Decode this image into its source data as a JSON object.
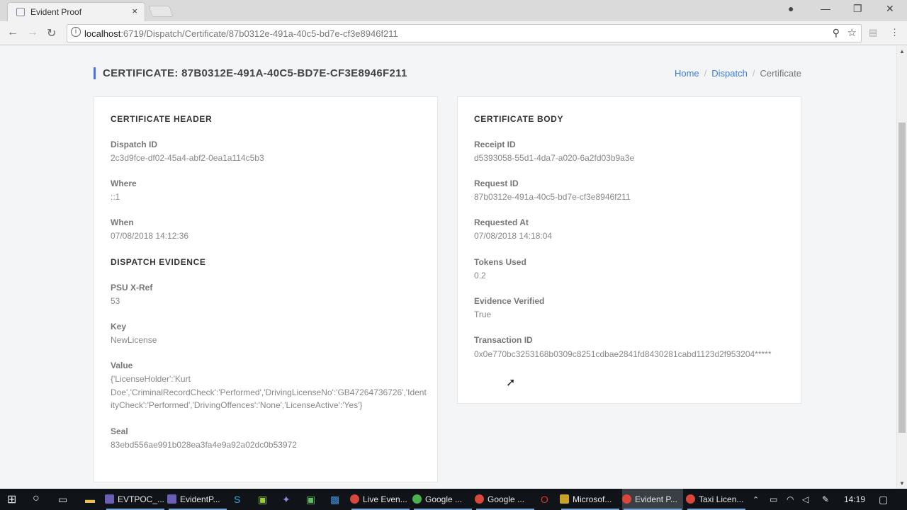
{
  "browser": {
    "tab_title": "Evident Proof",
    "tab_close": "×",
    "url_host": "localhost",
    "url_rest": ":6719/Dispatch/Certificate/87b0312e-491a-40c5-bd7e-cf3e8946f211",
    "info_glyph": "i"
  },
  "page": {
    "title": "CERTIFICATE: 87B0312E-491A-40C5-BD7E-CF3E8946F211",
    "breadcrumb": {
      "home": "Home",
      "dispatch": "Dispatch",
      "current": "Certificate",
      "separator": "/"
    }
  },
  "left_card": {
    "header_title": "CERTIFICATE HEADER",
    "dispatch_id_label": "Dispatch ID",
    "dispatch_id_value": "2c3d9fce-df02-45a4-abf2-0ea1a114c5b3",
    "where_label": "Where",
    "where_value": "::1",
    "when_label": "When",
    "when_value": "07/08/2018 14:12:36",
    "evidence_title": "DISPATCH EVIDENCE",
    "psu_label": "PSU X-Ref",
    "psu_value": "53",
    "key_label": "Key",
    "key_value": "NewLicense",
    "value_label": "Value",
    "value_value": "{'LicenseHolder':'Kurt Doe','CriminalRecordCheck':'Performed','DrivingLicenseNo':'GB47264736726','IdentityCheck':'Performed','DrivingOffences':'None','LicenseActive':'Yes'}",
    "seal_label": "Seal",
    "seal_value": "83ebd556ae991b028ea3fa4e9a92a02dc0b53972"
  },
  "right_card": {
    "body_title": "CERTIFICATE BODY",
    "receipt_label": "Receipt ID",
    "receipt_value": "d5393058-55d1-4da7-a020-6a2fd03b9a3e",
    "request_label": "Request ID",
    "request_value": "87b0312e-491a-40c5-bd7e-cf3e8946f211",
    "requested_at_label": "Requested At",
    "requested_at_value": "07/08/2018 14:18:04",
    "tokens_label": "Tokens Used",
    "tokens_value": "0.2",
    "verified_label": "Evidence Verified",
    "verified_value": "True",
    "transaction_label": "Transaction ID",
    "transaction_value": "0x0e770bc3253168b0309c8251cdbae2841fd8430281cabd1123d2f953204*****"
  },
  "taskbar": {
    "items": [
      "EVTPOC_...",
      "EvidentP...",
      "Live Even...",
      "Google ...",
      "Google ...",
      "Microsof...",
      "Evident P...",
      "Taxi Licen..."
    ],
    "clock": "14:19"
  },
  "icons": {
    "back": "back-arrow-icon",
    "forward": "forward-arrow-icon",
    "reload": "reload-icon",
    "zoom": "zoom-icon",
    "star": "bookmark-star-icon"
  }
}
